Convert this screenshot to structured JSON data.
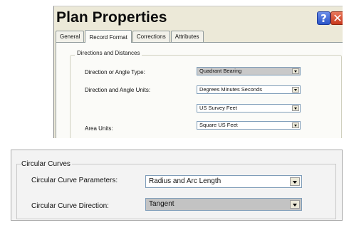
{
  "dialog": {
    "title": "Plan Properties",
    "help_glyph": "?",
    "close_glyph": "✕",
    "tabs": [
      "General",
      "Record Format",
      "Corrections",
      "Attributes"
    ],
    "active_tab": "Record Format",
    "group_title": "Directions and Distances",
    "rows": [
      {
        "label": "Direction or Angle Type:",
        "value": "Quadrant Bearing"
      },
      {
        "label": "Direction and Angle Units:",
        "value": "Degrees Minutes Seconds"
      },
      {
        "label": "",
        "value": "US Survey Feet"
      },
      {
        "label": "Area Units:",
        "value": "Square US Feet"
      }
    ]
  },
  "curves": {
    "group_title": "Circular Curves",
    "parameters_label": "Circular Curve Parameters:",
    "parameters_value": "Radius and Arc Length",
    "direction_label": "Circular Curve Direction:",
    "direction_value": "Tangent"
  },
  "colors": {
    "dialog_bg": "#ece9d8",
    "help_button": "#2b55c9",
    "close_button": "#c8381c",
    "selected_combo_bg": "#c9c9c9"
  }
}
